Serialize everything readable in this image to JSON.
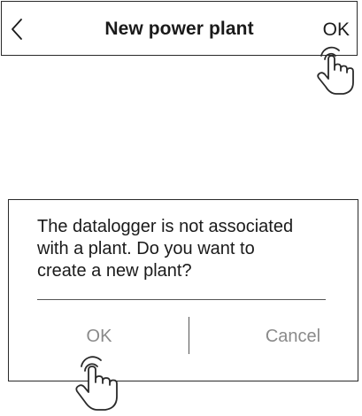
{
  "header": {
    "title": "New power plant",
    "back_icon": "chevron-left-icon",
    "confirm_label": "OK"
  },
  "dialog": {
    "message": "The datalogger is not associated\nwith a plant. Do you want to\ncreate a new plant?",
    "ok_label": "OK",
    "cancel_label": "Cancel"
  },
  "pointers": {
    "icon": "tap-hand-icon"
  },
  "colors": {
    "border": "#2a2a2a",
    "text": "#1a1a1a",
    "muted_button_text": "#8a8a8a"
  }
}
